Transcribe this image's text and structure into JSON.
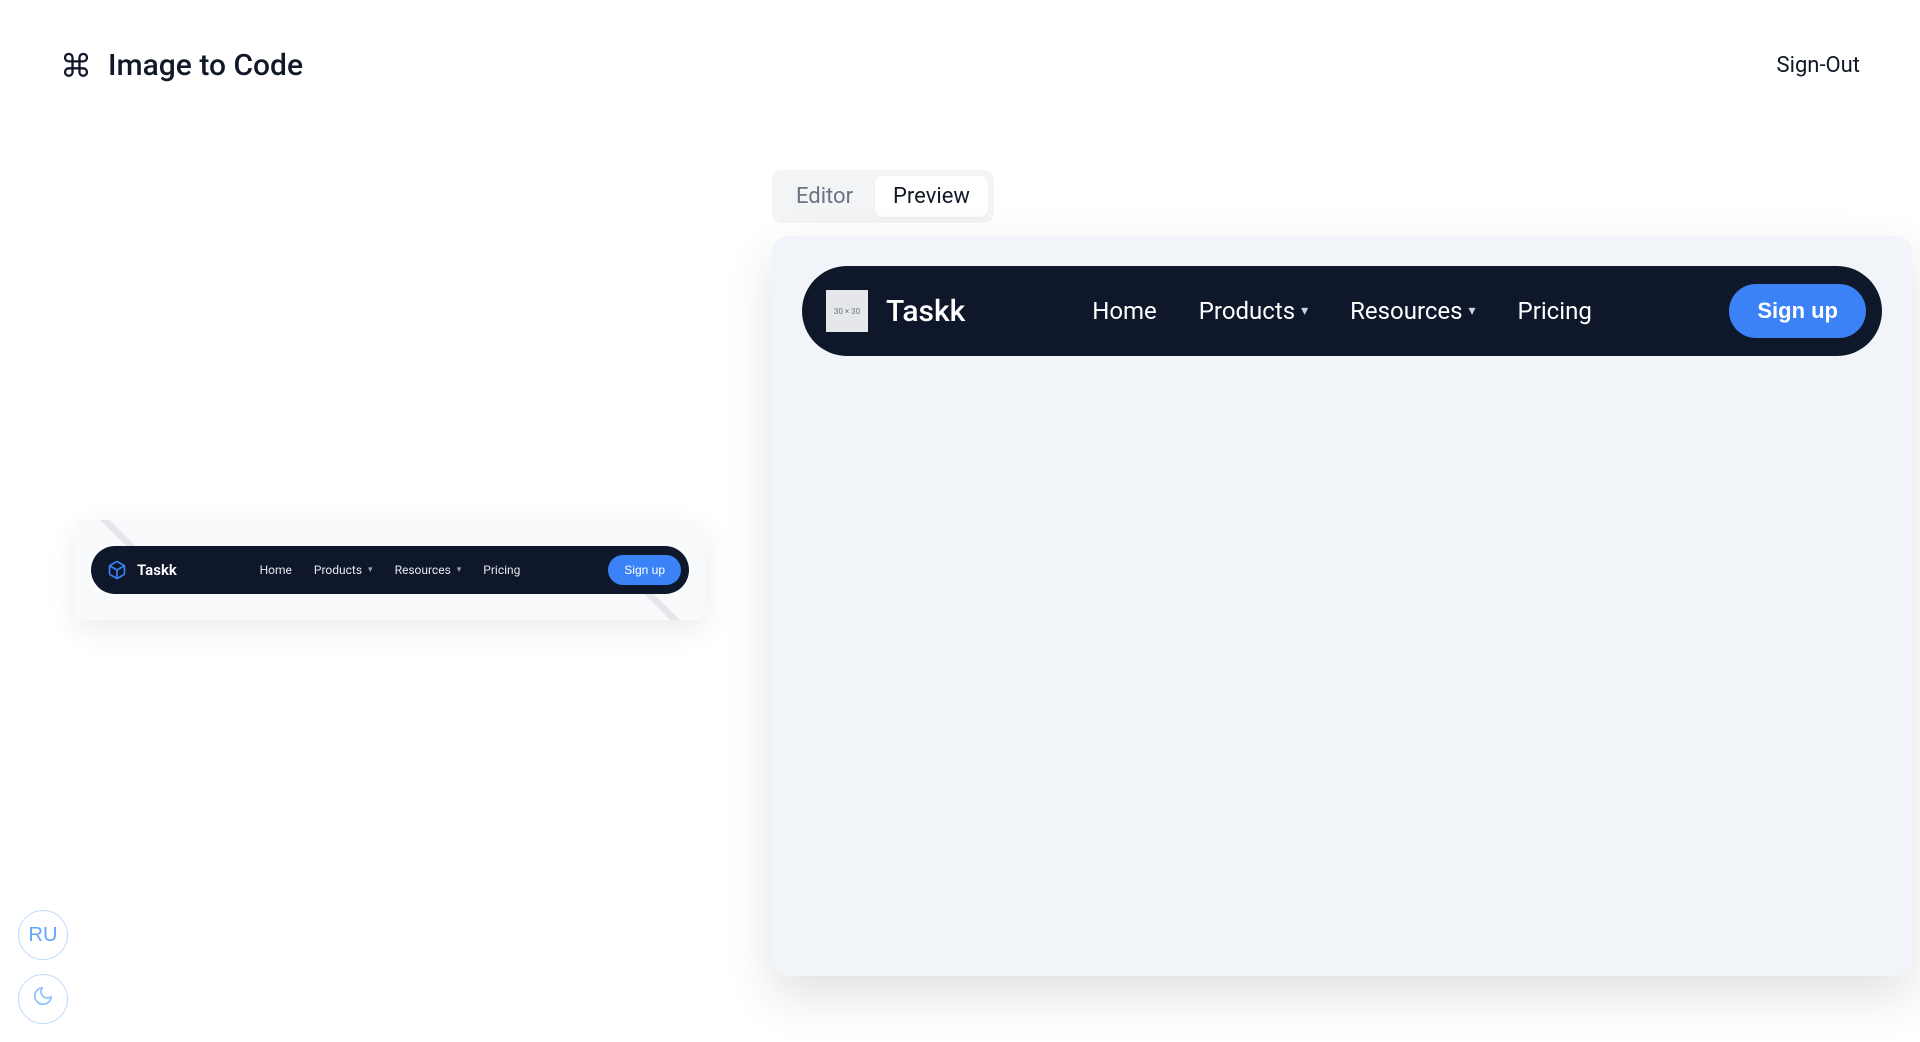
{
  "header": {
    "app_title": "Image to Code",
    "signout_label": "Sign-Out"
  },
  "tabs": {
    "editor_label": "Editor",
    "preview_label": "Preview",
    "active": "Preview"
  },
  "thumbnail": {
    "brand": "Taskk",
    "nav": {
      "home": "Home",
      "products": "Products",
      "resources": "Resources",
      "pricing": "Pricing"
    },
    "signup_label": "Sign up"
  },
  "preview": {
    "brand": "Taskk",
    "logo_placeholder_text": "30 × 30",
    "nav": {
      "home": "Home",
      "products": "Products",
      "resources": "Resources",
      "pricing": "Pricing"
    },
    "signup_label": "Sign up"
  },
  "float": {
    "language_badge": "RU"
  },
  "colors": {
    "navbar_bg": "#0f172a",
    "accent_blue": "#3b82f6",
    "panel_bg": "#f1f5f9"
  }
}
